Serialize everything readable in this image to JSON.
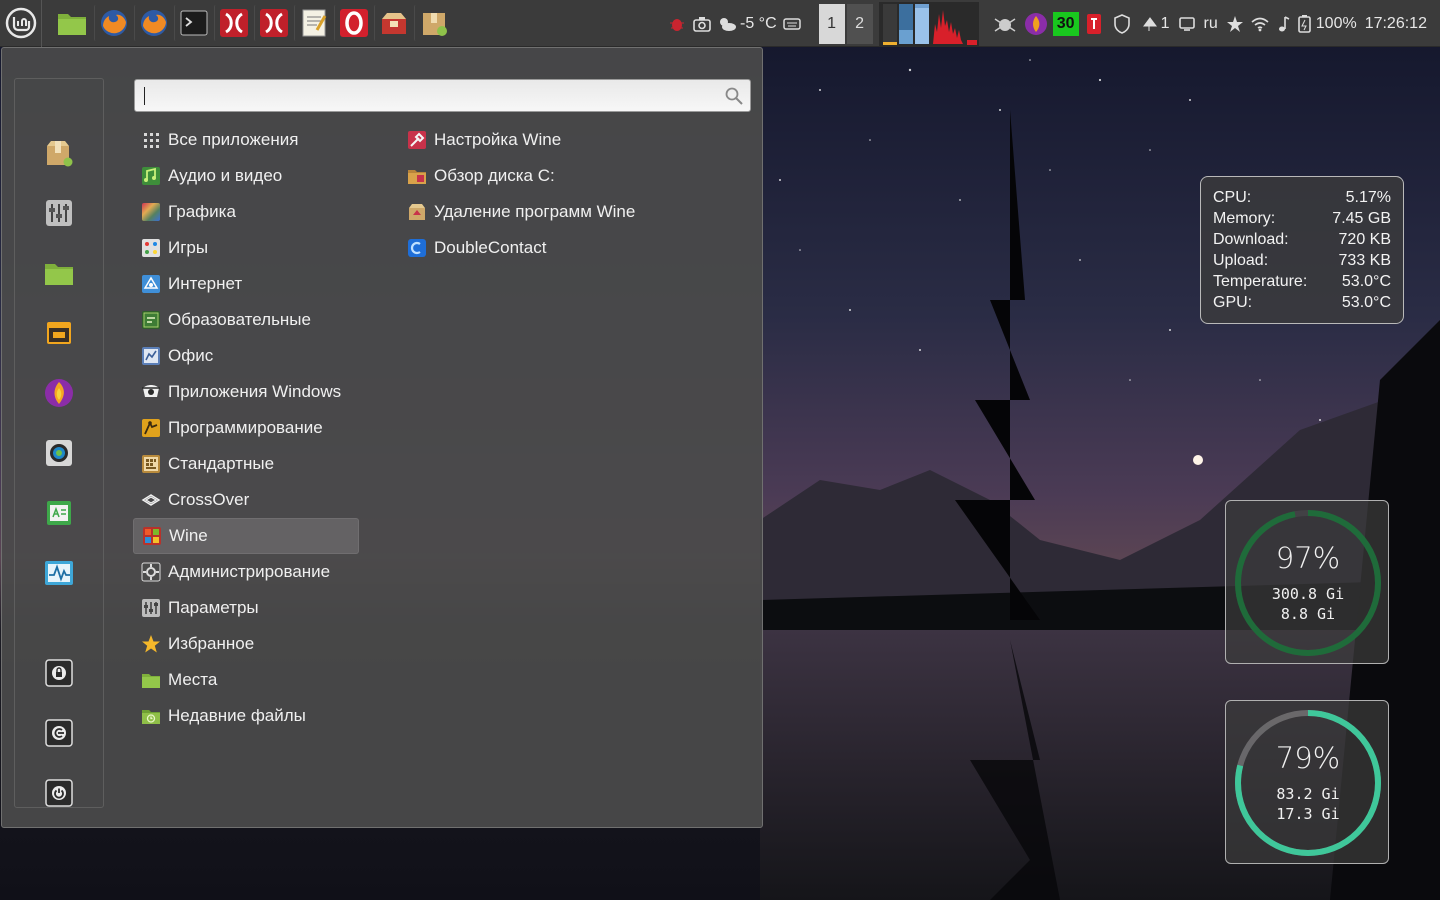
{
  "panel": {
    "launchers": [
      "files-icon",
      "firefox-icon",
      "firefox-icon",
      "terminal-icon",
      "crossover-icon",
      "crossover-icon",
      "text-editor-icon",
      "opera-icon",
      "package-installer-icon",
      "archive-manager-icon"
    ],
    "weather_text": "-5 °C",
    "workspaces": [
      "1",
      "2"
    ],
    "badge_count": "30",
    "notifications_count": "1",
    "keyboard_layout": "ru",
    "battery_text": "100%",
    "clock": "17:26:12"
  },
  "menu": {
    "search": {
      "value": "",
      "placeholder": ""
    },
    "favorites": [
      "package-installer-icon",
      "settings-icon",
      "files-icon",
      "calendar-icon",
      "firefox-icon",
      "colour-icon",
      "dictionary-icon",
      "system-monitor-icon",
      "lock-screen-icon",
      "logout-icon",
      "shutdown-icon"
    ],
    "categories": [
      {
        "label": "Все приложения",
        "icon": "grid-icon"
      },
      {
        "label": "Аудио и видео",
        "icon": "audio-video-icon"
      },
      {
        "label": "Графика",
        "icon": "graphics-icon"
      },
      {
        "label": "Игры",
        "icon": "games-icon"
      },
      {
        "label": "Интернет",
        "icon": "internet-icon"
      },
      {
        "label": "Образовательные",
        "icon": "education-icon"
      },
      {
        "label": "Офис",
        "icon": "office-icon"
      },
      {
        "label": "Приложения Windows",
        "icon": "windows-apps-icon"
      },
      {
        "label": "Программирование",
        "icon": "programming-icon"
      },
      {
        "label": "Стандартные",
        "icon": "accessories-icon"
      },
      {
        "label": "CrossOver",
        "icon": "crossover-icon"
      },
      {
        "label": "Wine",
        "icon": "wine-icon"
      },
      {
        "label": "Администрирование",
        "icon": "administration-icon"
      },
      {
        "label": "Параметры",
        "icon": "preferences-icon"
      },
      {
        "label": "Избранное",
        "icon": "star-icon"
      },
      {
        "label": "Места",
        "icon": "folder-icon"
      },
      {
        "label": "Недавние файлы",
        "icon": "recent-files-icon"
      }
    ],
    "selected_category": "Wine",
    "apps": [
      {
        "label": "Настройка Wine",
        "icon": "wine-config-icon"
      },
      {
        "label": "Обзор диска C:",
        "icon": "drive-c-icon"
      },
      {
        "label": "Удаление программ Wine",
        "icon": "wine-uninstall-icon"
      },
      {
        "label": "DoubleContact",
        "icon": "doublecontact-icon"
      }
    ]
  },
  "sysmon": {
    "rows": [
      {
        "label": "CPU:",
        "value": "5.17%"
      },
      {
        "label": "Memory:",
        "value": "7.45 GB"
      },
      {
        "label": "Download:",
        "value": "720 KB"
      },
      {
        "label": "Upload:",
        "value": "733 KB"
      },
      {
        "label": "Temperature:",
        "value": "53.0°C"
      },
      {
        "label": "GPU:",
        "value": "53.0°C"
      }
    ]
  },
  "disks": [
    {
      "percent_text": "97%",
      "percent": 97,
      "used": "300.8 Gi",
      "free": "8.8 Gi",
      "color": "#1f6b3a"
    },
    {
      "percent_text": "79%",
      "percent": 79,
      "used": "83.2 Gi",
      "free": "17.3 Gi",
      "color": "#3fc79a"
    }
  ],
  "colors": {
    "panel_bg": "#3b3b3b",
    "menu_bg": "#4a4a4a",
    "mint_green": "#8fc24a"
  }
}
